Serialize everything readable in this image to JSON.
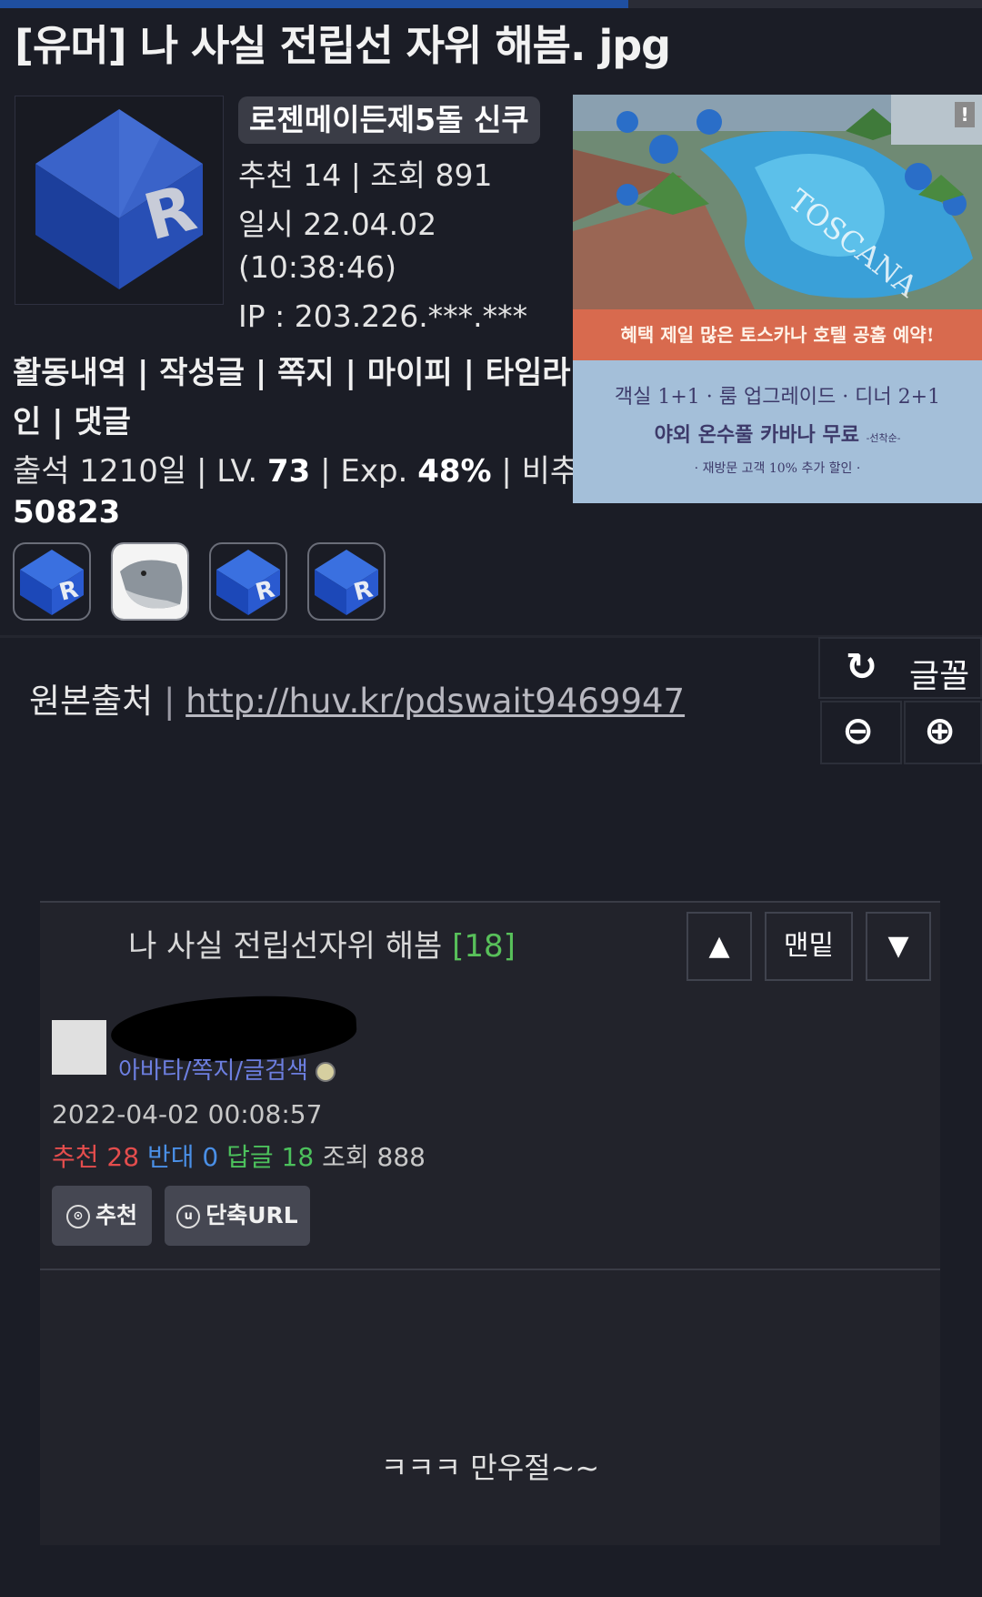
{
  "progress": {
    "fraction": 0.64
  },
  "post": {
    "title": "[유머] 나 사실 전립선 자위 해봄. jpg",
    "author": {
      "nickname": "로젠메이든제5돌 신쿠",
      "recommend_views": "추천 14 | 조회 891",
      "date": "일시 22.04.02",
      "time": "(10:38:46)",
      "ip": "IP : 203.226.***.***"
    },
    "links_line1": "활동내역 | 작성글 | 쪽지 | 마이피 | 타임라",
    "links_line2": "인 | 댓글",
    "stats": {
      "attendance": "출석 1210일",
      "sep1": " |  ",
      "lv_label": "LV. ",
      "lv_value": "73",
      "sep2": "  | ",
      "exp_label": "Exp. ",
      "exp_value": "48%",
      "sep3": " | ",
      "points_label": "비추력",
      "points_value": "50823"
    }
  },
  "ad": {
    "band_text": "혜택 제일 많은 토스카나 호텔 공홈 예약!",
    "line1": "객실 1+1 · 룸 업그레이드 · 디너 2+1",
    "line2": "야외 온수풀 카바나 무료",
    "line2_note": "-선착순-",
    "line3": "· 재방문 고객 10% 추가 할인 ·",
    "photo_text": "TOSCANA",
    "badge": "!"
  },
  "source": {
    "label": "원본출처",
    "sep": "|",
    "url": "http://huv.kr/pdswait9469947"
  },
  "toolbar": {
    "refresh_icon": "↻",
    "font_label": "글꼴",
    "zoom_out_icon": "⊖",
    "zoom_in_icon": "⊕"
  },
  "thread": {
    "title": "나 사실 전립선자위 해봄 ",
    "count": "[18]",
    "up_label": "▲",
    "bottom_label": "맨밑",
    "down_label": "▼"
  },
  "original_post": {
    "menu_link": "아바타/쪽지/글검색",
    "date": "2022-04-02 00:08:57",
    "rec_label": "추천 ",
    "rec_value": "28",
    "opp_label": " 반대 ",
    "opp_value": "0",
    "reply_label": " 답글 ",
    "reply_value": "18",
    "view_label": " 조회 ",
    "view_value": "888",
    "recommend_btn": "추천",
    "recommend_icon": "⊙",
    "shorturl_btn": "단축URL",
    "shorturl_icon": "u",
    "body": "ㅋㅋㅋ 만우절~~"
  },
  "colors": {
    "background": "#1b1d26",
    "panel": "#22232b",
    "accent_blue": "#1f4fa0",
    "recommend_red": "#e44d4d",
    "opposed_blue": "#4a8fe6",
    "reply_green": "#4cc15c",
    "link_purple": "#6d7fe0"
  }
}
